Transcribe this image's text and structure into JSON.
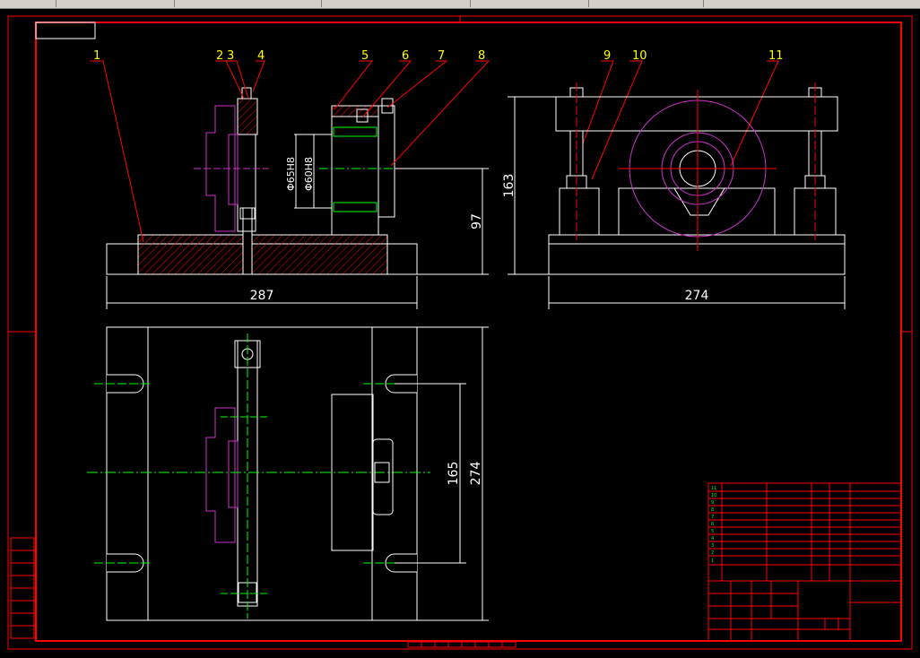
{
  "window": {
    "tabs": [
      "",
      "",
      "",
      "",
      "",
      ""
    ]
  },
  "labels": [
    "1",
    "2",
    "3",
    "4",
    "5",
    "6",
    "7",
    "8",
    "9",
    "10",
    "11"
  ],
  "dims": {
    "front_width": "287",
    "front_height": "97",
    "side_width": "274",
    "side_height": "163",
    "top_height_outer": "274",
    "top_height_inner": "165",
    "dia1": "Φ65H8",
    "dia2": "Φ60H8"
  },
  "colors": {
    "frame": "#ff0000",
    "lines": "#ffffff",
    "labels": "#ffff00",
    "part": "#cc33cc",
    "leaders": "#ff0000",
    "centerlines": "#00ff00",
    "hatch": "#ff0000"
  },
  "bom": {
    "rows": [
      "11",
      "10",
      "9",
      "8",
      "7",
      "6",
      "5",
      "4",
      "3",
      "2",
      "1"
    ]
  }
}
